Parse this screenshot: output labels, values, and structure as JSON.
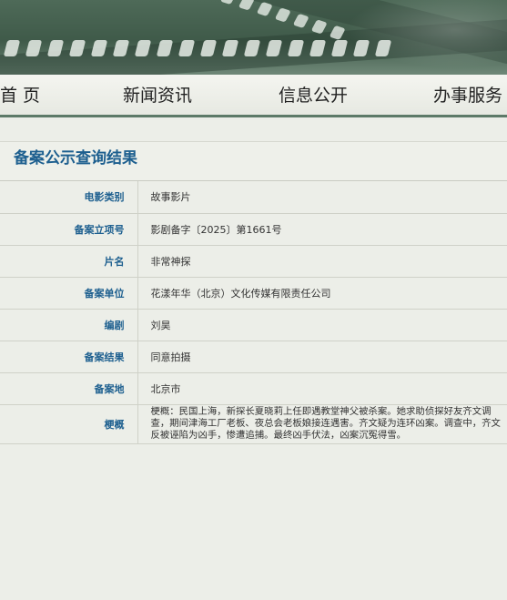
{
  "nav": {
    "items": [
      {
        "label": "首 页"
      },
      {
        "label": "新闻资讯"
      },
      {
        "label": "信息公开"
      },
      {
        "label": "办事服务"
      }
    ]
  },
  "page": {
    "title": "备案公示查询结果"
  },
  "record": {
    "rows": [
      {
        "label": "电影类别",
        "value": "故事影片"
      },
      {
        "label": "备案立项号",
        "value": "影剧备字〔2025〕第1661号"
      },
      {
        "label": "片名",
        "value": "非常神探"
      },
      {
        "label": "备案单位",
        "value": "花漾年华（北京）文化传媒有限责任公司"
      },
      {
        "label": "编剧",
        "value": "刘昊"
      },
      {
        "label": "备案结果",
        "value": "同意拍摄"
      },
      {
        "label": "备案地",
        "value": "北京市"
      },
      {
        "label": "梗概",
        "value": "梗概：民国上海，新探长夏晓莉上任即遇教堂神父被杀案。她求助侦探好友齐文调查，期间津海工厂老板、夜总会老板娘接连遇害。齐文疑为连环凶案。调查中，齐文反被诬陷为凶手，惨遭追捕。最终凶手伏法，凶案沉冤得雪。"
      }
    ]
  },
  "colors": {
    "accent": "#1d5f8f",
    "nav_border": "#5d7a68",
    "background": "#eceee8"
  }
}
